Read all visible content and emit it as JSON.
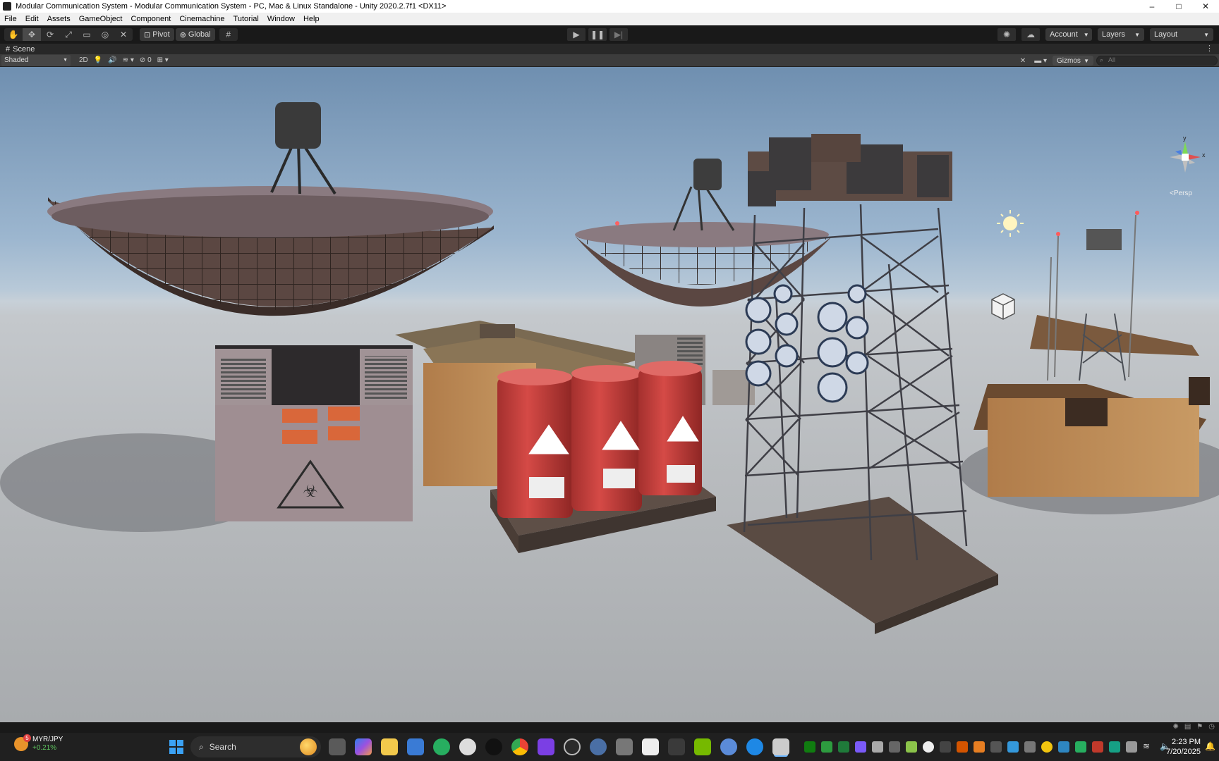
{
  "window": {
    "title": "Modular Communication System - Modular Communication System - PC, Mac & Linux Standalone - Unity 2020.2.7f1 <DX11>",
    "controls": [
      "–",
      "□",
      "✕"
    ]
  },
  "menu": [
    "File",
    "Edit",
    "Assets",
    "GameObject",
    "Component",
    "Cinemachine",
    "Tutorial",
    "Window",
    "Help"
  ],
  "toolbar": {
    "tools": [
      "hand-tool",
      "move-tool",
      "rotate-tool",
      "scale-tool",
      "rect-tool",
      "transform-tool",
      "custom-tool"
    ],
    "active_tool_index": 1,
    "pivot_label": "Pivot",
    "global_label": "Global",
    "account_label": "Account",
    "layers_label": "Layers",
    "layout_label": "Layout"
  },
  "scene_tab": {
    "label": "Scene"
  },
  "scene_toolbar": {
    "draw_mode": "Shaded",
    "mode_2d": "2D",
    "hidden_count": "0",
    "gizmos_label": "Gizmos",
    "search_placeholder": "All"
  },
  "gizmo": {
    "projection": "Persp",
    "y_label": "y",
    "x_label": "x"
  },
  "taskbar": {
    "ticker_pair": "MYR/JPY",
    "ticker_change": "+0.21%",
    "ticker_badge": "5",
    "search_label": "Search",
    "time": "2:23 PM",
    "date": "7/20/2025"
  },
  "colors": {
    "sky": "#9cb6cf",
    "ground": "#b9bcbf",
    "barrel_red": "#c93c3a",
    "dish_rim": "#8a7a80",
    "accent_blue": "#3ba2f5"
  }
}
